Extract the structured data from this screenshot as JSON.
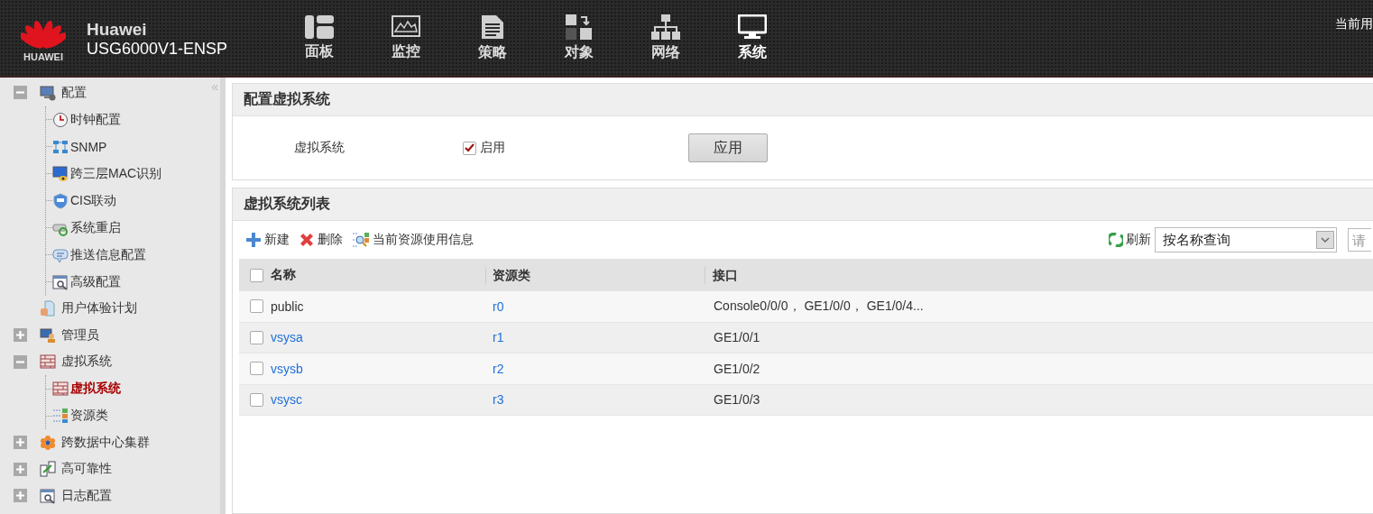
{
  "header": {
    "brand": "Huawei",
    "logo_text": "HUAWEI",
    "model": "USG6000V1-ENSP",
    "user_text": "当前用",
    "tabs": [
      {
        "label": "面板",
        "selected": false
      },
      {
        "label": "监控",
        "selected": false
      },
      {
        "label": "策略",
        "selected": false
      },
      {
        "label": "对象",
        "selected": false
      },
      {
        "label": "网络",
        "selected": false
      },
      {
        "label": "系统",
        "selected": true
      }
    ]
  },
  "sidebar": {
    "collapse": "«",
    "items": [
      {
        "label": "配置",
        "kind": "folder",
        "expanded": true,
        "selected": false,
        "children": [
          {
            "label": "时钟配置",
            "selected": false
          },
          {
            "label": "SNMP",
            "selected": false
          },
          {
            "label": "跨三层MAC识别",
            "selected": false
          },
          {
            "label": "CIS联动",
            "selected": false
          },
          {
            "label": "系统重启",
            "selected": false
          },
          {
            "label": "推送信息配置",
            "selected": false
          },
          {
            "label": "高级配置",
            "selected": false
          }
        ]
      },
      {
        "label": "用户体验计划",
        "kind": "leaf",
        "selected": false
      },
      {
        "label": "管理员",
        "kind": "folder",
        "expanded": false,
        "selected": false
      },
      {
        "label": "虚拟系统",
        "kind": "folder",
        "expanded": true,
        "selected": false,
        "children": [
          {
            "label": "虚拟系统",
            "selected": true
          },
          {
            "label": "资源类",
            "selected": false
          }
        ]
      },
      {
        "label": "跨数据中心集群",
        "kind": "folder",
        "expanded": false,
        "selected": false
      },
      {
        "label": "高可靠性",
        "kind": "folder",
        "expanded": false,
        "selected": false
      },
      {
        "label": "日志配置",
        "kind": "folder",
        "expanded": false,
        "selected": false
      }
    ]
  },
  "config_panel": {
    "title": "配置虚拟系统",
    "field_label": "虚拟系统",
    "checkbox": {
      "label": "启用",
      "checked": true
    },
    "apply_button": "应用"
  },
  "list_panel": {
    "title": "虚拟系统列表",
    "toolbar": [
      {
        "kind": "add",
        "label": "新建"
      },
      {
        "kind": "delete",
        "label": "删除"
      },
      {
        "kind": "usage",
        "label": "当前资源使用信息"
      }
    ],
    "refresh": "刷新",
    "query_select": "按名称查询",
    "search_placeholder": "请",
    "table": {
      "columns": [
        "名称",
        "资源类",
        "接口"
      ],
      "header_checked": false,
      "rows": [
        {
          "checked": false,
          "name": "public",
          "name_link": false,
          "resource_class": "r0",
          "interfaces": "Console0/0/0， GE1/0/0， GE1/0/4..."
        },
        {
          "checked": false,
          "name": "vsysa",
          "name_link": true,
          "resource_class": "r1",
          "interfaces": "GE1/0/1"
        },
        {
          "checked": false,
          "name": "vsysb",
          "name_link": true,
          "resource_class": "r2",
          "interfaces": "GE1/0/2"
        },
        {
          "checked": false,
          "name": "vsysc",
          "name_link": true,
          "resource_class": "r3",
          "interfaces": "GE1/0/3"
        }
      ]
    }
  }
}
